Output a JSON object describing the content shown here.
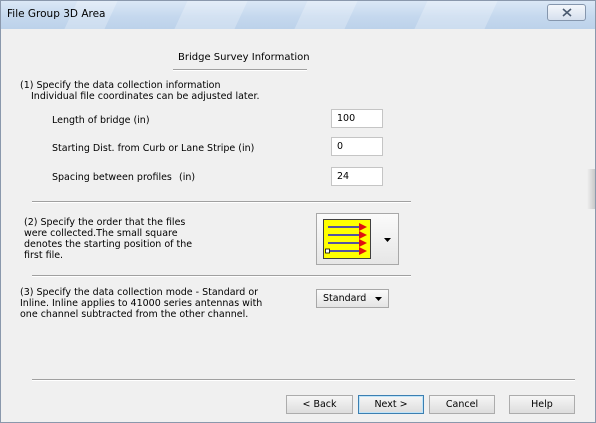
{
  "window": {
    "title": "File Group 3D Area"
  },
  "section": {
    "title": "Bridge Survey Information"
  },
  "step1": {
    "line1": "(1) Specify the data collection information",
    "line2": "Individual file coordinates can be adjusted later.",
    "length_label": "Length of bridge  (in)",
    "length_value": "100",
    "start_label": "Starting Dist. from Curb or Lane Stripe  (in)",
    "start_value": "0",
    "spacing_label": "Spacing between profiles",
    "spacing_unit": "(in)",
    "spacing_value": "24"
  },
  "step2": {
    "line1": "(2) Specify the order that the files",
    "line2": "were collected.The small square",
    "line3": "denotes the starting position of the",
    "line4": "first file.",
    "image_icon": "zigzag-order-icon",
    "colors": {
      "background": "#ffff00",
      "lines": "#1a1ad6",
      "arrows": "#e01010"
    }
  },
  "step3": {
    "line1": "(3) Specify the data collection mode - Standard or",
    "line2": "Inline. Inline applies to 41000 series antennas with",
    "line3": "one channel subtracted from the other channel.",
    "mode_selected": "Standard"
  },
  "buttons": {
    "back": "< Back",
    "next": "Next >",
    "cancel": "Cancel",
    "help": "Help"
  }
}
